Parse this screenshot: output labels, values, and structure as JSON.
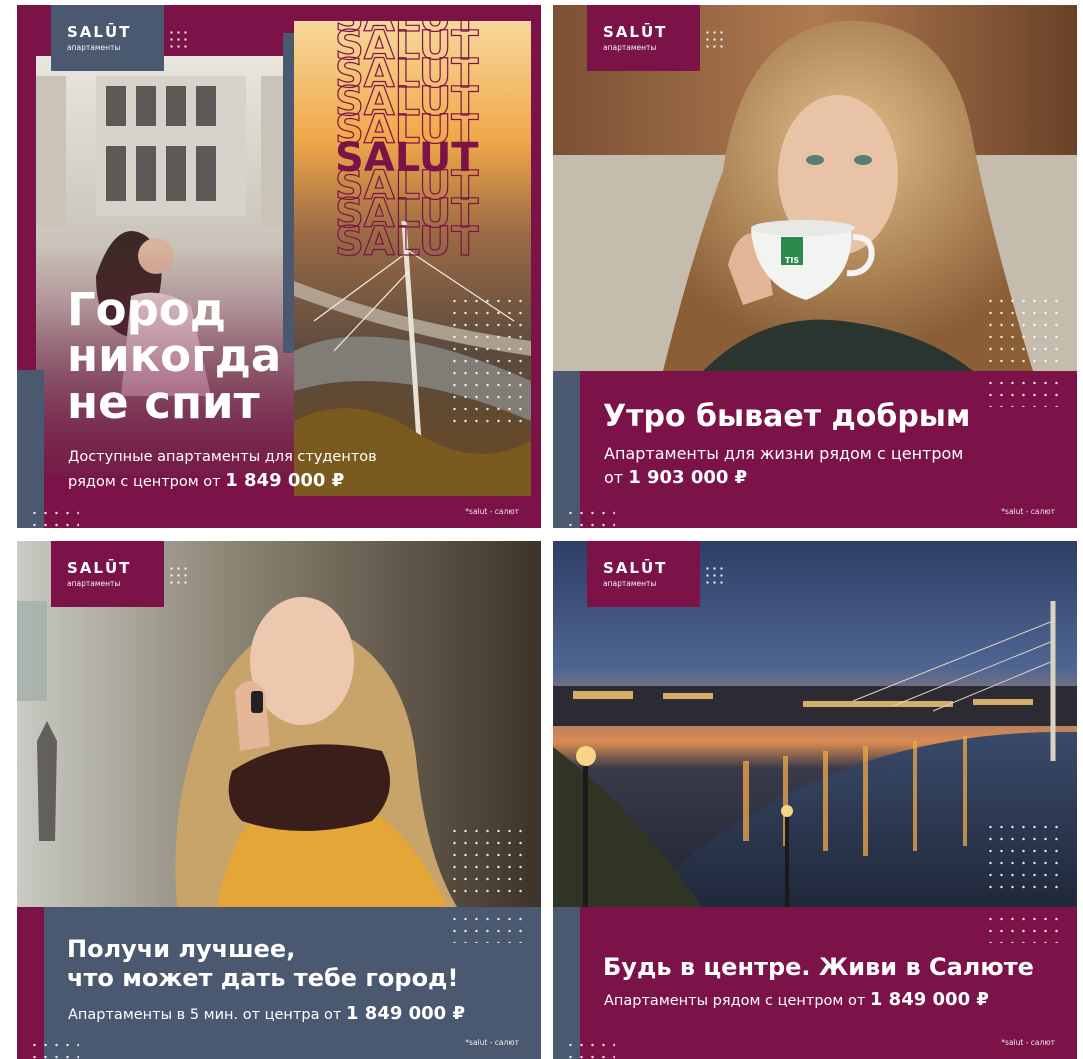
{
  "logo": {
    "word": "SALŪT",
    "sub": "апартаменты"
  },
  "colors": {
    "plum": "#7b1248",
    "slate": "#4a5870"
  },
  "footnote": "*salut - салют",
  "banners": [
    {
      "heading": "Город\nникогда\nне спит",
      "sub_line1": "Доступные апартаменты для студентов",
      "sub_prefix": "рядом с центром от ",
      "price": "1 849 000 ₽",
      "repeated_word": "SALUT"
    },
    {
      "heading": "Утро бывает добрым",
      "sub_line1": "Апартаменты для жизни рядом с центром",
      "sub_prefix": "от ",
      "price": "1 903 000 ₽",
      "cup_label": "TIS"
    },
    {
      "heading": "Получи лучшее,\nчто может дать тебе город!",
      "sub_prefix": "Апартаменты в 5 мин. от центра от ",
      "price": "1 849 000 ₽"
    },
    {
      "heading": "Будь в центре. Живи в Салюте",
      "sub_prefix": "Апартаменты рядом с центром от ",
      "price": "1 849 000 ₽"
    }
  ]
}
